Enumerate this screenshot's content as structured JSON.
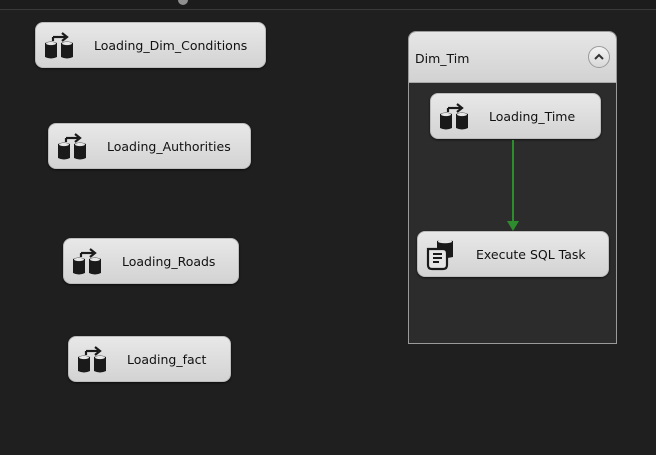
{
  "tasks": [
    {
      "label": "Loading_Dim_Conditions",
      "icon": "data-flow-task-icon"
    },
    {
      "label": "Loading_Authorities",
      "icon": "data-flow-task-icon"
    },
    {
      "label": "Loading_Roads",
      "icon": "data-flow-task-icon"
    },
    {
      "label": "Loading_fact",
      "icon": "data-flow-task-icon"
    }
  ],
  "container": {
    "title": "Dim_Tim",
    "collapse_icon": "chevron-up-icon",
    "tasks": [
      {
        "label": "Loading_Time",
        "icon": "data-flow-task-icon"
      },
      {
        "label": "Execute SQL Task",
        "icon": "execute-sql-task-icon"
      }
    ],
    "precedence_color": "#2e8b2e"
  },
  "colors": {
    "canvas_bg": "#1f1f1f",
    "task_bg": "#dcdcdc",
    "container_body": "#2c2c2c"
  }
}
